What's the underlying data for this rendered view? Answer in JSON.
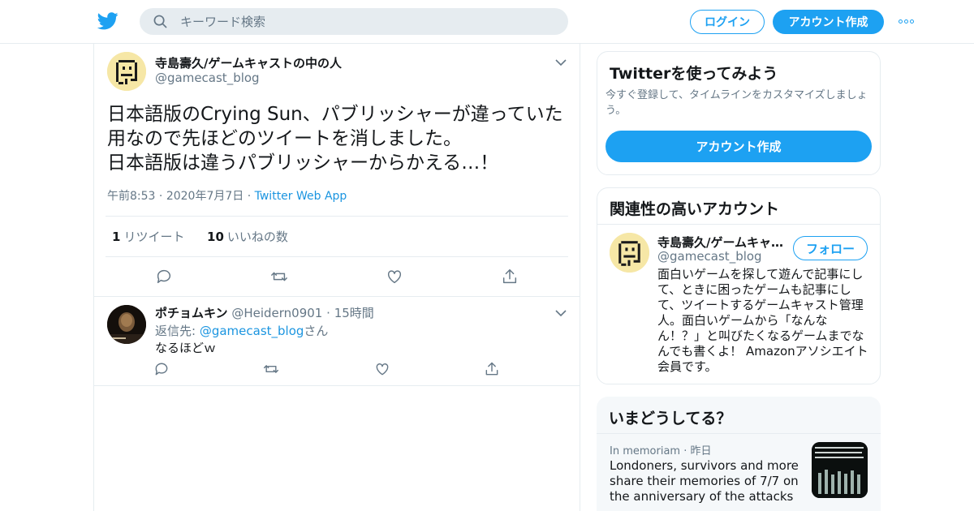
{
  "header": {
    "search_placeholder": "キーワード検索",
    "login_label": "ログイン",
    "signup_label": "アカウント作成"
  },
  "tweet": {
    "author_name": "寺島壽久/ゲームキャストの中の人",
    "author_handle": "@gamecast_blog",
    "text": "日本語版のCrying Sun、パブリッシャーが違っていた\n用なので先ほどのツイートを消しました。\n日本語版は違うパブリッシャーからかえる…！",
    "time": "午前8:53",
    "date": "2020年7月7日",
    "source": "Twitter Web App",
    "retweet_count": "1",
    "retweet_label": "リツイート",
    "like_count": "10",
    "like_label": "いいねの数"
  },
  "reply": {
    "author_name": "ポチョムキン",
    "author_handle": "@Heidern0901",
    "time": "15時間",
    "reply_to_label": "返信先: ",
    "reply_to_handle": "@gamecast_blog",
    "reply_to_suffix": "さん",
    "text": "なるほどｗ"
  },
  "signup_card": {
    "title": "Twitterを使ってみよう",
    "subtitle": "今すぐ登録して、タイムラインをカスタマイズしましょう。",
    "button": "アカウント作成"
  },
  "related_card": {
    "title": "関連性の高いアカウント",
    "name": "寺島壽久/ゲームキャ…",
    "handle": "@gamecast_blog",
    "follow_label": "フォロー",
    "bio": "面白いゲームを探して遊んで記事にして、ときに困ったゲームも記事にして、ツイートするゲームキャスト管理人。面白いゲームから「なんなん！？」と叫びたくなるゲームまでなんでも書くよ！ Amazonアソシエイト会員です。"
  },
  "trends_card": {
    "title": "いまどうしてる？",
    "category": "In memoriam",
    "time": "昨日",
    "headline": "Londoners, survivors and more share their memories of 7/7 on the anniversary of the attacks"
  },
  "colors": {
    "accent": "#1da1f2",
    "link": "#1b95e0",
    "muted": "#657786",
    "border": "#e6ecf0"
  }
}
